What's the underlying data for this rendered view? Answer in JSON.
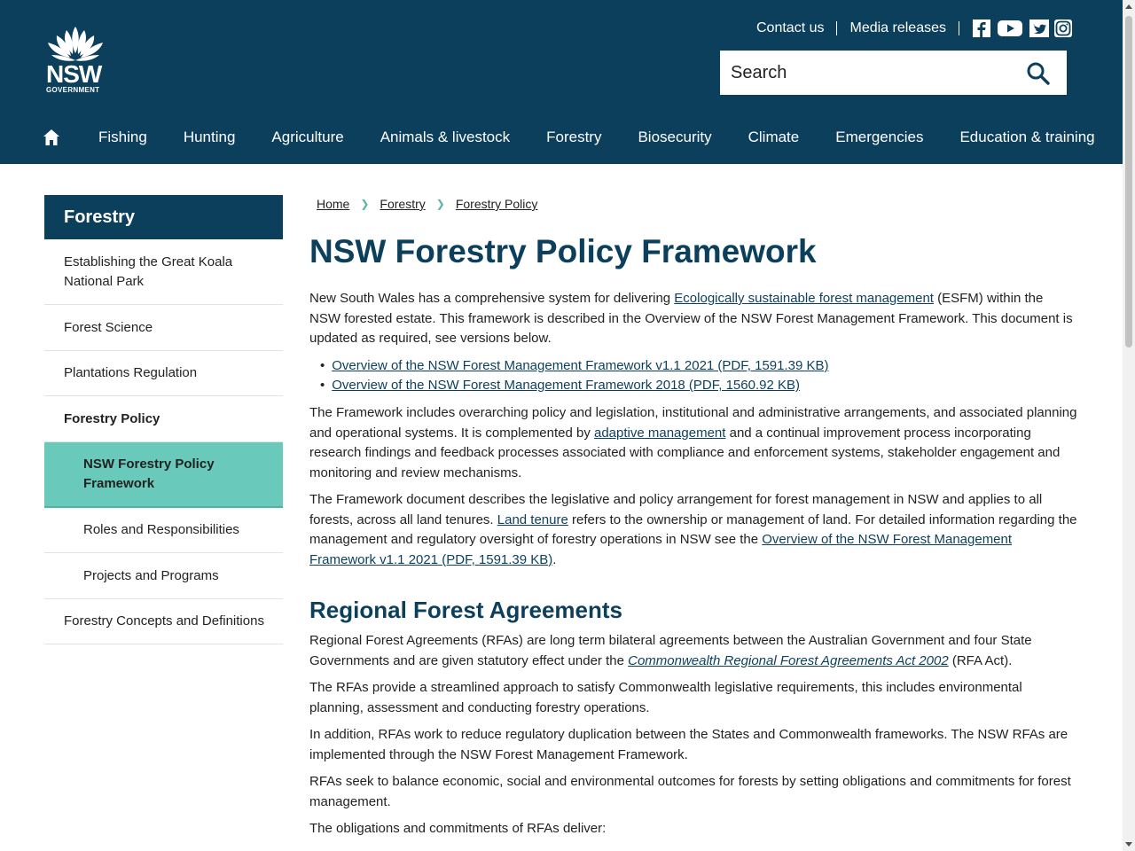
{
  "header": {
    "logo_text": "NSW",
    "logo_subtext": "GOVERNMENT",
    "top_links": [
      "Contact us",
      "Media releases"
    ],
    "social_icons": [
      "facebook-icon",
      "youtube-icon",
      "twitter-icon",
      "instagram-icon"
    ],
    "search_placeholder": "Search",
    "nav": [
      "Fishing",
      "Hunting",
      "Agriculture",
      "Animals & livestock",
      "Forestry",
      "Biosecurity",
      "Climate",
      "Emergencies",
      "Education & training"
    ]
  },
  "sidebar": {
    "title": "Forestry",
    "items": [
      {
        "label": "Establishing the Great Koala National Park"
      },
      {
        "label": "Forest Science"
      },
      {
        "label": "Plantations Regulation"
      },
      {
        "label": "Forestry Policy"
      },
      {
        "label": "NSW Forestry Policy Framework"
      },
      {
        "label": "Roles and Responsibilities"
      },
      {
        "label": "Projects and Programs"
      },
      {
        "label": "Forestry Concepts and Definitions"
      }
    ]
  },
  "breadcrumb": [
    "Home",
    "Forestry",
    "Forestry Policy"
  ],
  "main": {
    "title": "NSW Forestry Policy Framework",
    "p1": {
      "before": "New South Wales has a comprehensive system for delivering ",
      "link": "Ecologically sustainable forest management",
      "after": " (ESFM) within the NSW forested estate. This framework is described in the Overview of the NSW Forest Management Framework. This document is updated as required, see versions below."
    },
    "files": [
      "Overview of the NSW Forest Management Framework v1.1 2021 (PDF, 1591.39 KB)",
      "Overview of the NSW Forest Management Framework 2018 (PDF, 1560.92 KB)"
    ],
    "p2": {
      "before": "The Framework includes overarching policy and legislation, institutional and administrative arrangements, and associated planning and operational systems. It is complemented by ",
      "link": "adaptive management",
      "after": " and a continual improvement process incorporating research findings and feedback processes associated with compliance and enforcement systems, stakeholder engagement and monitoring and review mechanisms."
    },
    "p3": {
      "before": "The Framework document describes the legislative and policy arrangement for forest management in NSW and applies to all forests, across all land tenures. ",
      "link": "Land tenure",
      "middle": " refers to the ownership or management of land. For detailed information regarding the management and regulatory oversight of forestry operations in NSW see the ",
      "link2": "Overview of the NSW Forest Management Framework v1.1 2021 (PDF, 1591.39 KB)",
      "after": "."
    },
    "h2": "Regional Forest Agreements",
    "p4": {
      "before": "Regional Forest Agreements (RFAs) are long term bilateral agreements between the Australian Government and four State Governments and are given statutory effect under the ",
      "link": "Commonwealth Regional Forest Agreements Act 2002",
      "after": " (RFA Act)."
    },
    "p5": "The RFAs provide a streamlined approach to satisfy Commonwealth legislative requirements, this includes environmental planning, assessment and conducting forestry operations.",
    "p6": "In addition, RFAs work to reduce regulatory duplication between the States and Commonwealth frameworks. The NSW RFAs are implemented through the NSW Forest Management Framework.",
    "p7": "RFAs seek to balance economic, social and environmental outcomes for forests by setting obligations and commitments for forest management.",
    "p8": "The obligations and commitments of RFAs deliver:"
  },
  "colors": {
    "header_bg": "#0b3f5c",
    "active_item_bg": "#69c9bb",
    "breadcrumb_chevron": "#5ab3a8"
  }
}
